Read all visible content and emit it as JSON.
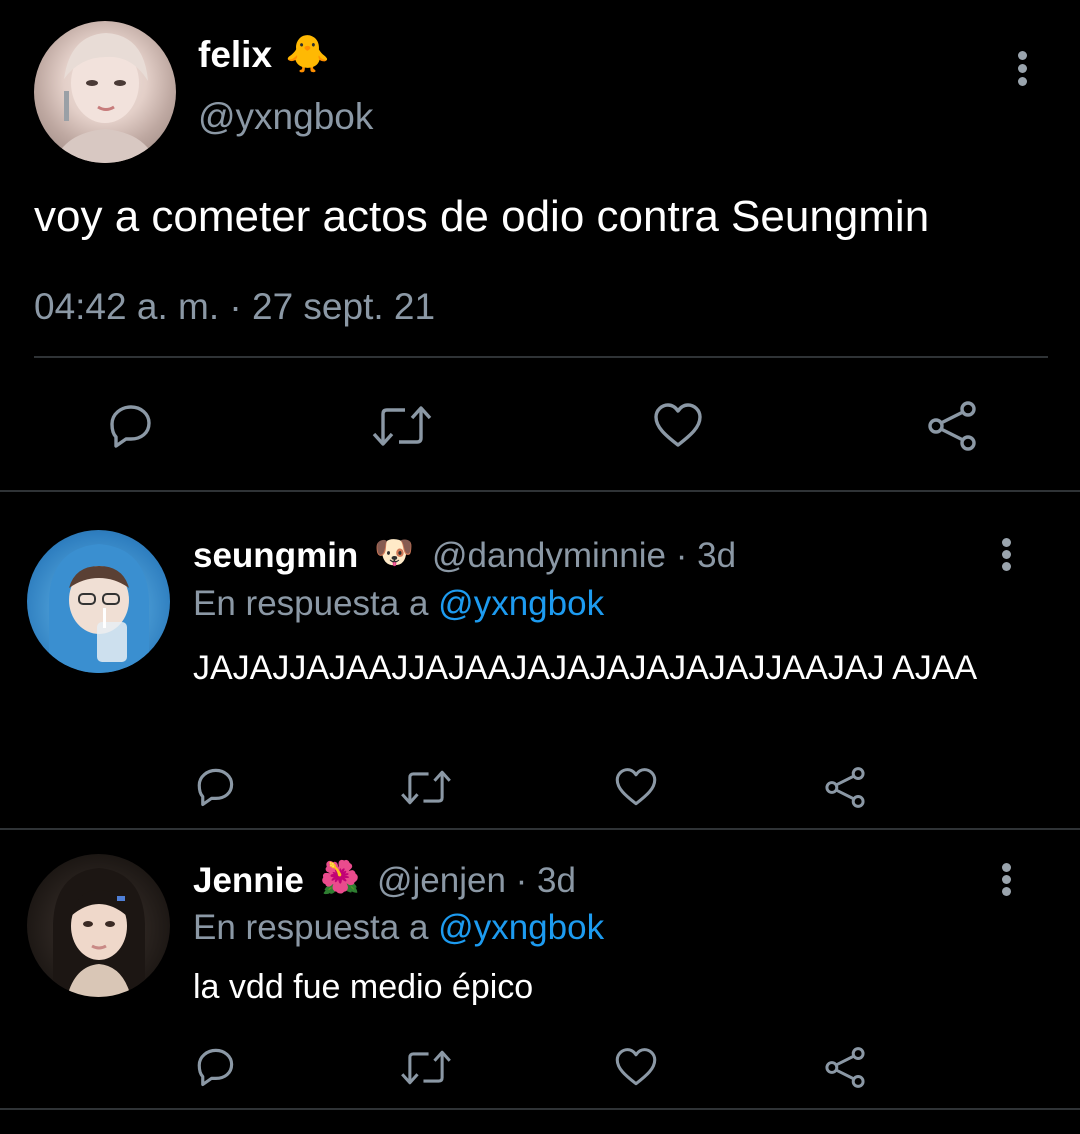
{
  "main_tweet": {
    "name": "felix",
    "name_emoji": "🐥",
    "handle": "@yxngbok",
    "text": "voy a cometer actos de odio contra Seungmin",
    "timestamp": "04:42 a. m. · 27 sept. 21",
    "avatar": "felix-avatar"
  },
  "replies": [
    {
      "name": "seungmin",
      "name_emoji": "🐶",
      "handle": "@dandyminnie · 3d",
      "reply_prefix": "En respuesta a",
      "reply_mention": "@yxngbok",
      "text": "JAJAJJAJAAJJAJAAJAJAJAJAJAJAJJAAJAJ AJAA",
      "avatar": "seungmin-avatar"
    },
    {
      "name": "Jennie",
      "name_emoji": "🌺",
      "handle": "@jenjen · 3d",
      "reply_prefix": "En respuesta a",
      "reply_mention": "@yxngbok",
      "text": "la vdd fue medio épico",
      "avatar": "jennie-avatar"
    }
  ],
  "icons": [
    "reply-icon",
    "retweet-icon",
    "like-icon",
    "share-icon",
    "more-options-icon"
  ],
  "colors": {
    "background": "#000000",
    "primary_text": "#ffffff",
    "secondary_text": "#8b98a5",
    "link": "#1d9bf0",
    "divider": "#2f3336",
    "icon": "#8b98a5"
  }
}
